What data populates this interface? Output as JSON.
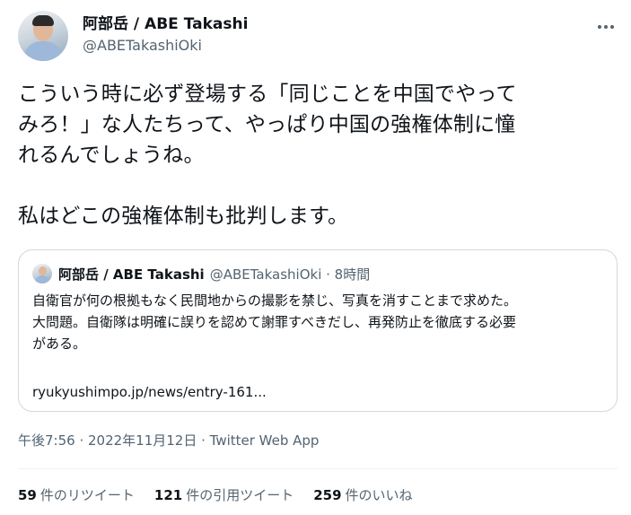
{
  "author": {
    "display_name": "阿部岳 / ABE Takashi",
    "handle": "@ABETakashiOki"
  },
  "tweet": {
    "text": "こういう時に必ず登場する「同じことを中国でやって\nみろ！」な人たちって、やっぱり中国の強権体制に憧\nれるんでしょうね。\n\n私はどこの強権体制も批判します。"
  },
  "quoted_tweet": {
    "display_name": "阿部岳 / ABE Takashi",
    "handle_time": "@ABETakashiOki · 8時間",
    "text": "自衛官が何の根拠もなく民間地からの撮影を禁じ、写真を消すことまで求めた。\n大問題。自衛隊は明確に誤りを認めて謝罪すべきだし、再発防止を徹底する必要\nがある。",
    "link": "ryukyushimpo.jp/news/entry-161..."
  },
  "meta": "午後7:56 · 2022年11月12日 · Twitter Web App",
  "stats": {
    "retweets": {
      "count": "59",
      "label": "件のリツイート"
    },
    "quotes": {
      "count": "121",
      "label": "件の引用ツイート"
    },
    "likes": {
      "count": "259",
      "label": "件のいいね"
    }
  },
  "colors": {
    "text": "#0f1419",
    "secondary": "#536471",
    "border": "#cfd9de"
  }
}
